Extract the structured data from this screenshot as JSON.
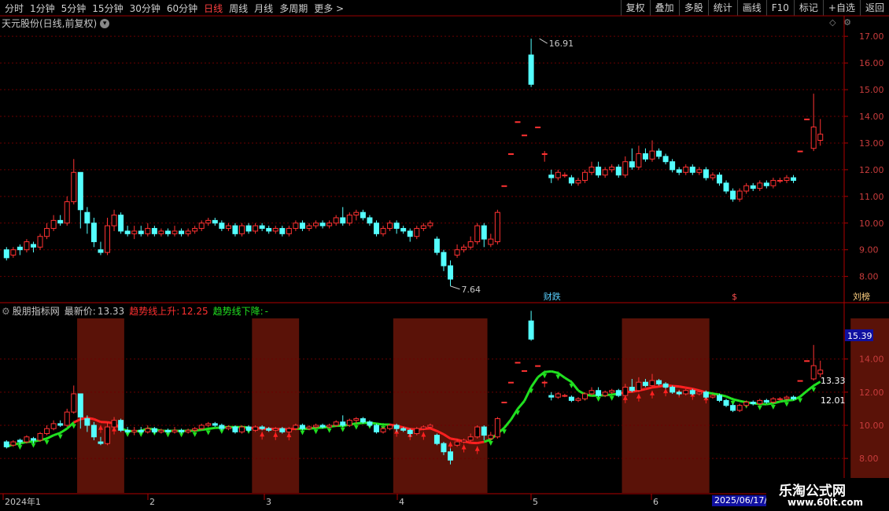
{
  "toolbar": {
    "left": [
      "分时",
      "1分钟",
      "5分钟",
      "15分钟",
      "30分钟",
      "60分钟",
      "日线",
      "周线",
      "月线",
      "多周期",
      "更多 >"
    ],
    "active": "日线",
    "right": [
      "复权",
      "叠加",
      "多股",
      "统计",
      "画线",
      "F10",
      "标记",
      "+自选",
      "返回"
    ]
  },
  "main_chart": {
    "title": "天元股份(日线,前复权)",
    "high_label": "16.91",
    "low_label": "7.64",
    "markers": [
      "财跌",
      "$",
      "刘榜"
    ]
  },
  "indicator": {
    "name": "股朋指标网",
    "latest_label": "最新价:",
    "latest_value": "13.33",
    "up_label": "趋势线上升:",
    "up_value": "12.25",
    "down_label": "趋势线下降:",
    "down_value": "-",
    "badge": "15.39",
    "price_tag": "13.33",
    "trend_tag": "12.01"
  },
  "x_axis": {
    "labels": [
      "2024年1",
      "2",
      "3",
      "4",
      "5",
      "6"
    ],
    "cursor_date": "2025/06/17/二"
  },
  "watermark": {
    "line1": "乐淘公式网",
    "line2": "www.60lt.com"
  },
  "colors": {
    "up": "#ff3232",
    "down": "#54ffff",
    "trend_up": "#ff2020",
    "trend_down": "#20e020",
    "shade": "#5a1208",
    "grid": "#6a0000"
  },
  "chart_data": [
    {
      "type": "candlestick",
      "title": "天元股份(日线,前复权)",
      "y_ticks": [
        8.0,
        9.0,
        10.0,
        11.0,
        12.0,
        13.0,
        14.0,
        15.0,
        16.0,
        17.0
      ],
      "ylim": [
        7.4,
        17.3
      ],
      "candles": [
        [
          9.0,
          8.7,
          9.1,
          8.6
        ],
        [
          8.8,
          9.0,
          9.1,
          8.7
        ],
        [
          9.1,
          9.0,
          9.2,
          8.8
        ],
        [
          9.0,
          9.3,
          9.4,
          8.9
        ],
        [
          9.2,
          9.1,
          9.3,
          8.9
        ],
        [
          9.1,
          9.5,
          9.6,
          9.0
        ],
        [
          9.5,
          9.8,
          10.0,
          9.4
        ],
        [
          9.8,
          10.1,
          10.3,
          9.7
        ],
        [
          10.1,
          10.0,
          10.3,
          9.9
        ],
        [
          10.0,
          10.8,
          11.0,
          9.9
        ],
        [
          10.8,
          11.9,
          12.4,
          10.7
        ],
        [
          11.9,
          10.5,
          11.0,
          9.8
        ],
        [
          10.4,
          10.0,
          10.6,
          9.6
        ],
        [
          10.0,
          9.3,
          10.2,
          9.1
        ],
        [
          9.0,
          8.9,
          9.3,
          8.8
        ],
        [
          8.9,
          9.9,
          10.2,
          8.8
        ],
        [
          9.9,
          10.3,
          10.5,
          9.7
        ],
        [
          10.3,
          9.7,
          10.4,
          9.6
        ],
        [
          9.7,
          9.6,
          9.9,
          9.5
        ],
        [
          9.6,
          9.7,
          9.9,
          9.4
        ],
        [
          9.7,
          9.6,
          9.9,
          9.5
        ],
        [
          9.6,
          9.8,
          10.0,
          9.5
        ],
        [
          9.8,
          9.6,
          9.9,
          9.5
        ],
        [
          9.6,
          9.7,
          9.8,
          9.5
        ],
        [
          9.7,
          9.6,
          9.8,
          9.5
        ],
        [
          9.6,
          9.7,
          9.9,
          9.5
        ],
        [
          9.7,
          9.6,
          9.8,
          9.5
        ],
        [
          9.6,
          9.7,
          9.8,
          9.5
        ],
        [
          9.7,
          9.8,
          9.9,
          9.6
        ],
        [
          9.8,
          10.0,
          10.1,
          9.7
        ],
        [
          10.0,
          10.1,
          10.2,
          9.9
        ],
        [
          10.1,
          10.0,
          10.2,
          9.9
        ],
        [
          10.0,
          9.8,
          10.1,
          9.7
        ],
        [
          9.8,
          9.9,
          10.0,
          9.7
        ],
        [
          9.9,
          9.6,
          10.0,
          9.5
        ],
        [
          9.6,
          9.9,
          10.0,
          9.5
        ],
        [
          9.9,
          9.7,
          10.0,
          9.6
        ],
        [
          9.7,
          9.9,
          10.0,
          9.6
        ],
        [
          9.9,
          9.8,
          10.0,
          9.7
        ],
        [
          9.8,
          9.7,
          9.9,
          9.6
        ],
        [
          9.7,
          9.8,
          9.9,
          9.6
        ],
        [
          9.8,
          9.6,
          9.9,
          9.5
        ],
        [
          9.6,
          9.8,
          9.9,
          9.5
        ],
        [
          9.8,
          10.0,
          10.1,
          9.7
        ],
        [
          10.0,
          9.8,
          10.1,
          9.7
        ],
        [
          9.8,
          9.9,
          10.0,
          9.7
        ],
        [
          9.9,
          10.0,
          10.1,
          9.8
        ],
        [
          10.0,
          9.9,
          10.1,
          9.8
        ],
        [
          9.9,
          10.0,
          10.1,
          9.8
        ],
        [
          10.0,
          10.2,
          10.3,
          9.9
        ],
        [
          10.2,
          10.0,
          10.6,
          9.9
        ],
        [
          10.0,
          10.3,
          10.4,
          9.9
        ],
        [
          10.3,
          10.4,
          10.5,
          10.1
        ],
        [
          10.4,
          10.2,
          10.5,
          10.1
        ],
        [
          10.2,
          10.0,
          10.3,
          9.9
        ],
        [
          10.0,
          9.6,
          10.1,
          9.5
        ],
        [
          9.6,
          9.8,
          9.9,
          9.5
        ],
        [
          9.8,
          10.0,
          10.1,
          9.7
        ],
        [
          10.0,
          9.8,
          10.1,
          9.6
        ],
        [
          9.8,
          9.7,
          9.9,
          9.6
        ],
        [
          9.7,
          9.5,
          9.8,
          9.3
        ],
        [
          9.5,
          9.8,
          9.9,
          9.4
        ],
        [
          9.8,
          9.9,
          10.0,
          9.7
        ],
        [
          9.9,
          10.0,
          10.1,
          9.8
        ],
        [
          9.4,
          8.9,
          9.5,
          8.8
        ],
        [
          8.9,
          8.4,
          9.0,
          8.2
        ],
        [
          8.4,
          7.9,
          8.6,
          7.64
        ],
        [
          8.8,
          9.0,
          9.2,
          8.7
        ],
        [
          9.0,
          9.1,
          9.2,
          8.9
        ],
        [
          9.1,
          9.3,
          9.5,
          9.0
        ],
        [
          9.3,
          9.9,
          10.0,
          9.2
        ],
        [
          9.9,
          9.4,
          10.0,
          9.1
        ],
        [
          9.2,
          9.4,
          9.6,
          9.1
        ],
        [
          9.3,
          10.4,
          10.5,
          9.2
        ],
        [
          11.4,
          11.4,
          11.4,
          11.4
        ],
        [
          12.6,
          12.6,
          12.6,
          12.6
        ],
        [
          13.8,
          13.8,
          13.8,
          13.8
        ],
        [
          13.3,
          13.3,
          13.3,
          13.3
        ],
        [
          16.3,
          15.2,
          16.91,
          15.1
        ],
        [
          13.6,
          13.6,
          13.6,
          13.6
        ],
        [
          12.6,
          12.6,
          12.7,
          12.3
        ],
        [
          11.8,
          11.7,
          12.0,
          11.5
        ],
        [
          11.7,
          11.9,
          12.0,
          11.6
        ],
        [
          11.8,
          11.8,
          11.9,
          11.7
        ],
        [
          11.7,
          11.5,
          11.8,
          11.4
        ],
        [
          11.5,
          11.6,
          11.7,
          11.4
        ],
        [
          11.6,
          11.9,
          12.0,
          11.5
        ],
        [
          11.9,
          12.1,
          12.3,
          11.8
        ],
        [
          12.1,
          11.8,
          12.3,
          11.7
        ],
        [
          11.8,
          12.0,
          12.1,
          11.7
        ],
        [
          12.0,
          12.1,
          12.2,
          11.9
        ],
        [
          12.1,
          11.8,
          12.2,
          11.7
        ],
        [
          11.8,
          12.3,
          12.5,
          11.7
        ],
        [
          12.3,
          12.1,
          12.8,
          12.0
        ],
        [
          12.1,
          12.6,
          12.9,
          12.0
        ],
        [
          12.6,
          12.4,
          12.8,
          12.3
        ],
        [
          12.4,
          12.7,
          13.1,
          12.3
        ],
        [
          12.7,
          12.5,
          12.8,
          12.4
        ],
        [
          12.5,
          12.3,
          12.6,
          12.2
        ],
        [
          12.3,
          12.0,
          12.4,
          11.9
        ],
        [
          12.0,
          11.9,
          12.1,
          11.8
        ],
        [
          11.9,
          12.1,
          12.2,
          11.8
        ],
        [
          12.1,
          11.9,
          12.2,
          11.8
        ],
        [
          11.9,
          12.0,
          12.1,
          11.8
        ],
        [
          12.0,
          11.7,
          12.1,
          11.6
        ],
        [
          11.7,
          11.8,
          11.9,
          11.6
        ],
        [
          11.8,
          11.5,
          11.9,
          11.4
        ],
        [
          11.5,
          11.2,
          11.6,
          11.1
        ],
        [
          11.2,
          10.9,
          11.3,
          10.8
        ],
        [
          10.9,
          11.2,
          11.3,
          10.8
        ],
        [
          11.2,
          11.4,
          11.5,
          11.1
        ],
        [
          11.4,
          11.3,
          11.5,
          11.2
        ],
        [
          11.3,
          11.5,
          11.6,
          11.2
        ],
        [
          11.5,
          11.4,
          11.6,
          11.3
        ],
        [
          11.4,
          11.6,
          11.7,
          11.3
        ],
        [
          11.6,
          11.6,
          11.7,
          11.5
        ],
        [
          11.6,
          11.7,
          11.8,
          11.5
        ],
        [
          11.7,
          11.6,
          11.8,
          11.5
        ],
        [
          12.7,
          12.7,
          12.7,
          12.7
        ],
        [
          13.9,
          13.9,
          13.9,
          13.9
        ],
        [
          12.8,
          13.6,
          14.85,
          12.7
        ],
        [
          13.1,
          13.33,
          13.9,
          12.9
        ]
      ]
    },
    {
      "type": "indicator",
      "y_ticks": [
        8.0,
        10.0,
        12.0,
        14.0
      ],
      "ylim": [
        7.2,
        16.5
      ]
    }
  ]
}
